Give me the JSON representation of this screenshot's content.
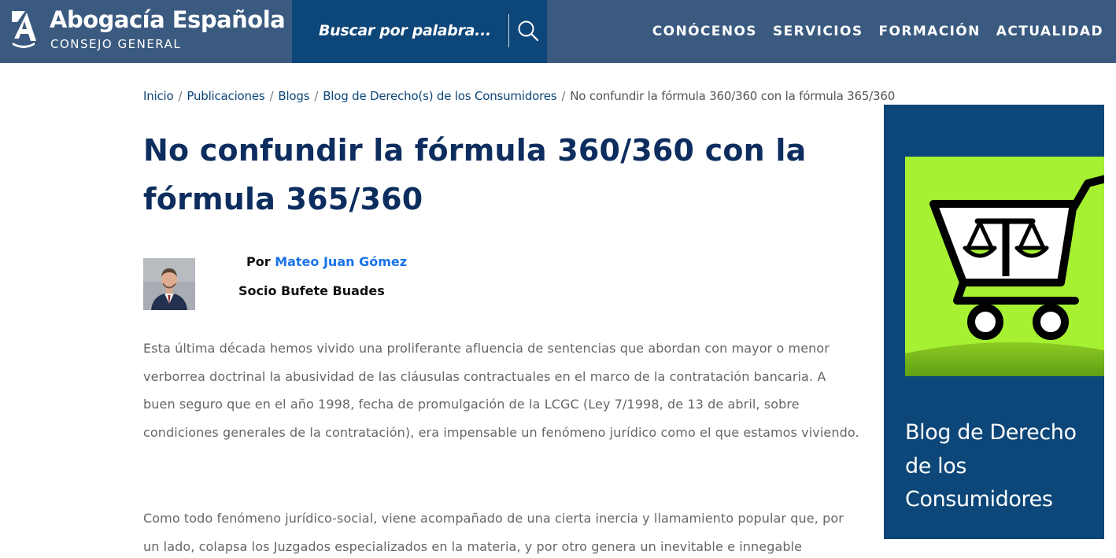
{
  "header": {
    "site_title": "Abogacía Española",
    "site_subtitle": "CONSEJO GENERAL",
    "logo_icon": "abogacia-logo-icon",
    "search_placeholder": "Buscar por palabra...",
    "search_icon": "search-icon",
    "nav": [
      {
        "label": "CONÓCENOS"
      },
      {
        "label": "SERVICIOS"
      },
      {
        "label": "FORMACIÓN"
      },
      {
        "label": "ACTUALIDAD"
      }
    ],
    "colors": {
      "bar": "#3a5a80",
      "search_bg": "#0d4678"
    }
  },
  "breadcrumb": {
    "items": [
      {
        "label": "Inicio"
      },
      {
        "label": "Publicaciones"
      },
      {
        "label": "Blogs"
      },
      {
        "label": "Blog de Derecho(s) de los Consumidores"
      }
    ],
    "separator": "/",
    "current": "No confundir la fórmula 360/360 con la fórmula 365/360"
  },
  "article": {
    "title": "No confundir la fórmula 360/360 con la fórmula 365/360",
    "byline_prefix": "Por",
    "author_name": "Mateo Juan Gómez",
    "author_role": "Socio Bufete Buades",
    "paragraphs": [
      "Esta última década hemos vivido una proliferante afluencia de sentencias que abordan con mayor o menor verborrea doctrinal la abusividad de las cláusulas contractuales en el marco de la contratación bancaria. A buen seguro que en el año 1998, fecha de promulgación de la LCGC (Ley 7/1998, de 13 de abril, sobre condiciones generales de la contratación), era impensable un fenómeno jurídico como el que estamos viviendo.",
      "Como todo fenómeno jurídico-social, viene acompañado de una cierta inercia y llamamiento popular que, por un lado, colapsa los Juzgados especializados en la materia, y por otro genera un inevitable e innegable"
    ],
    "colors": {
      "title": "#0d2d5e",
      "link": "#1a73e8",
      "body": "#666666"
    }
  },
  "sidebar": {
    "title": "Blog de Derecho de los Consumidores",
    "image_icon": "shopping-cart-scales-icon",
    "colors": {
      "panel": "#0d4678",
      "image_bg": "#a5f132"
    }
  }
}
